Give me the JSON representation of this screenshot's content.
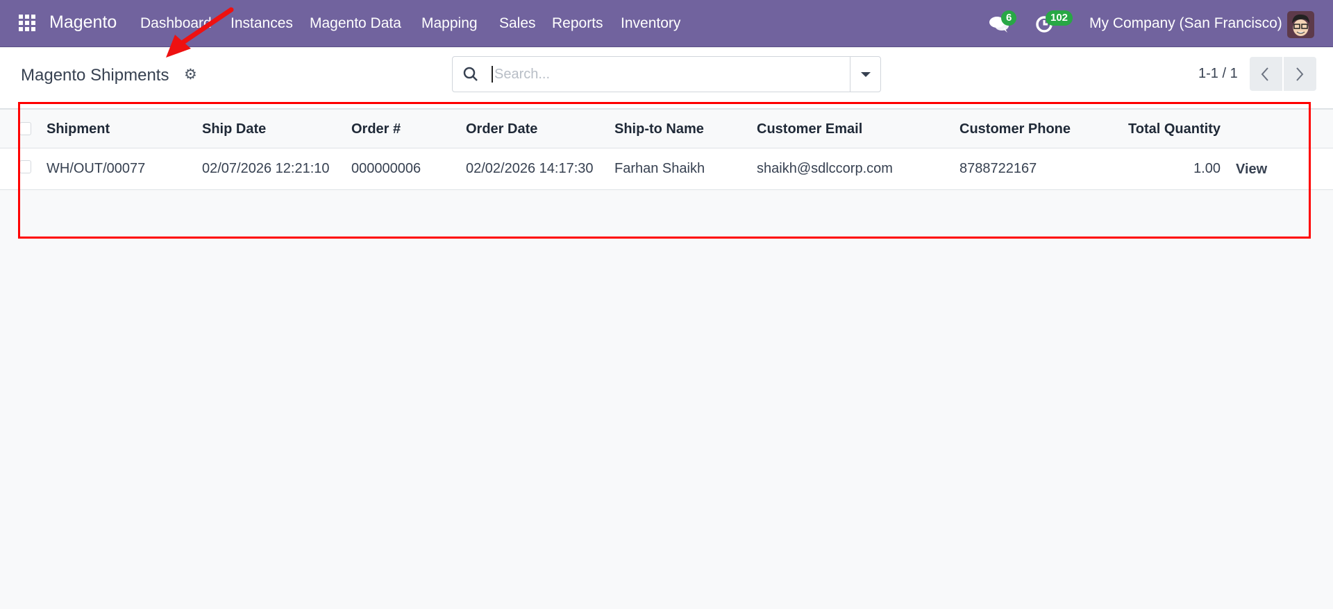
{
  "navbar": {
    "app_name": "Magento",
    "menu": [
      "Dashboard",
      "Instances",
      "Magento Data",
      "Mapping",
      "Sales",
      "Reports",
      "Inventory"
    ],
    "messages_count": "6",
    "activities_count": "102",
    "company": "My Company (San Francisco)",
    "badge_color": "#28a745",
    "brand_color": "#71639e"
  },
  "control_panel": {
    "title": "Magento Shipments",
    "search_placeholder": "Search...",
    "pager": "1-1 / 1"
  },
  "table": {
    "columns": [
      "Shipment",
      "Ship Date",
      "Order #",
      "Order Date",
      "Ship-to Name",
      "Customer Email",
      "Customer Phone",
      "Total Quantity"
    ],
    "rows": [
      {
        "shipment": "WH/OUT/00077",
        "ship_date": "02/07/2026 12:21:10",
        "order": "000000006",
        "order_date": "02/02/2026 14:17:30",
        "ship_to": "Farhan Shaikh",
        "email": "shaikh@sdlccorp.com",
        "phone": "8788722167",
        "qty": "1.00",
        "action": "View"
      }
    ]
  }
}
